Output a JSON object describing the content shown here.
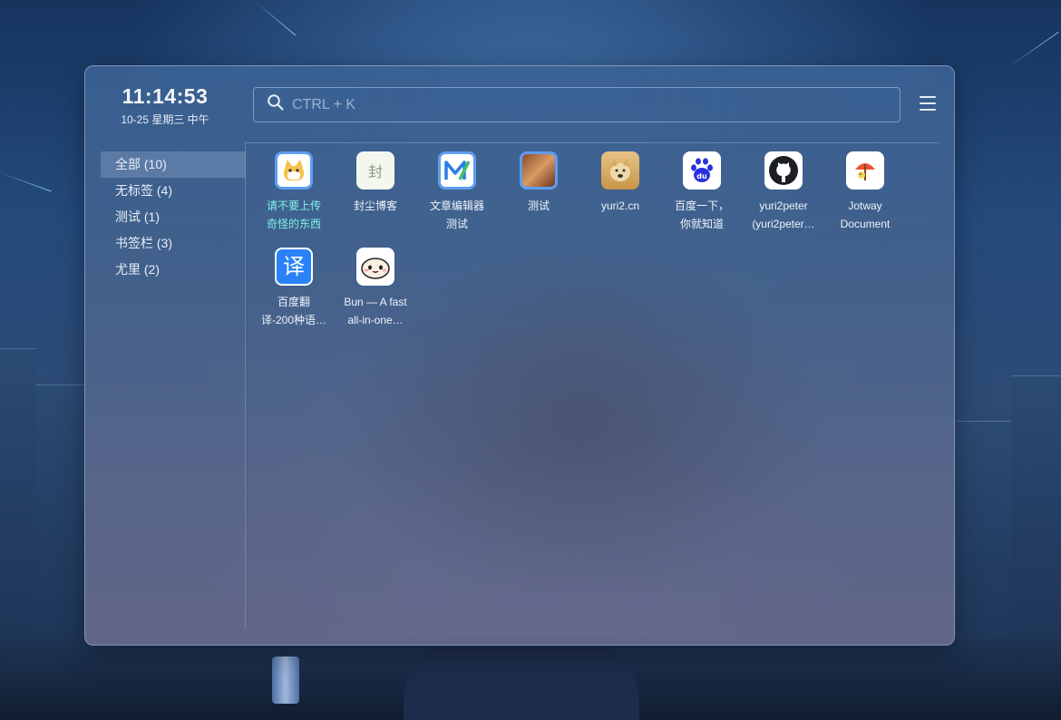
{
  "clock": {
    "time": "11:14:53",
    "date": "10-25 星期三 中午"
  },
  "search": {
    "placeholder": "CTRL + K"
  },
  "sidebar": {
    "items": [
      {
        "label": "全部 (10)",
        "active": true
      },
      {
        "label": "无标签 (4)"
      },
      {
        "label": "测试 (1)"
      },
      {
        "label": "书签栏 (3)"
      },
      {
        "label": "尤里 (2)"
      }
    ]
  },
  "bookmarks": [
    {
      "line1": "请不要上传",
      "line2": "奇怪的东西",
      "icon": "cat-mascot-icon",
      "highlight": true
    },
    {
      "line1": "封尘博客",
      "line2": "",
      "icon": "feng-blog-icon"
    },
    {
      "line1": "文章编辑器",
      "line2": "测试",
      "icon": "markdown-editor-icon"
    },
    {
      "line1": "测试",
      "line2": "",
      "icon": "photo-icon"
    },
    {
      "line1": "yuri2.cn",
      "line2": "",
      "icon": "doge-icon"
    },
    {
      "line1": "百度一下，",
      "line2": "你就知道",
      "icon": "baidu-icon"
    },
    {
      "line1": "yuri2peter",
      "line2": "(yuri2peter…",
      "icon": "github-icon"
    },
    {
      "line1": "Jotway",
      "line2": "Document",
      "icon": "umbrella-icon"
    },
    {
      "line1": "百度翻",
      "line2": "译-200种语…",
      "icon": "translate-icon",
      "glyph": "译"
    },
    {
      "line1": "Bun — A fast",
      "line2": "all-in-one…",
      "icon": "bun-icon"
    }
  ],
  "colors": {
    "accent": "#5f9df0",
    "highlight_text": "#7ff0e6",
    "baidu_blue": "#2932e1"
  }
}
